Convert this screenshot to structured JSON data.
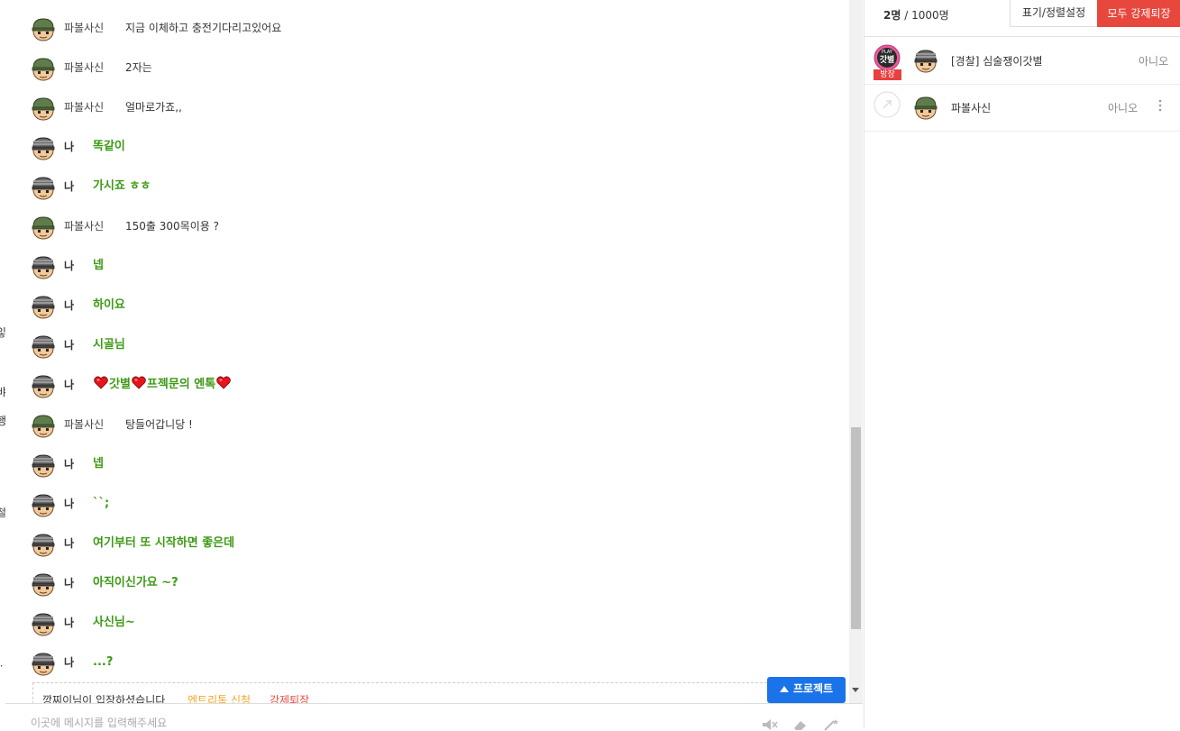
{
  "background_fragments": [
    "잏",
    "l",
    "뱌",
    "행",
    "-",
    "철",
    "-",
    "l",
    "ㆍ"
  ],
  "chat": {
    "messages": [
      {
        "nick": "파볼사신",
        "text": "지금 이체하고 충전기다리고있어요",
        "me": false
      },
      {
        "nick": "파볼사신",
        "text": "2자는",
        "me": false
      },
      {
        "nick": "파볼사신",
        "text": "얼마로가죠,,",
        "me": false
      },
      {
        "nick": "나",
        "text": "똑같이",
        "me": true
      },
      {
        "nick": "나",
        "text": "가시죠 ㅎㅎ",
        "me": true
      },
      {
        "nick": "파볼사신",
        "text": "150출 300목이용 ?",
        "me": false
      },
      {
        "nick": "나",
        "text": "넵",
        "me": true
      },
      {
        "nick": "나",
        "text": "하이요",
        "me": true
      },
      {
        "nick": "나",
        "text": "시골님",
        "me": true
      },
      {
        "nick": "나",
        "text_parts": [
          "갓별",
          "프젝문의 엔톡"
        ],
        "me": true,
        "hearts": true
      },
      {
        "nick": "파볼사신",
        "text": "탕들어갑니당 !",
        "me": false
      },
      {
        "nick": "나",
        "text": "넵",
        "me": true
      },
      {
        "nick": "나",
        "text": "``;",
        "me": true
      },
      {
        "nick": "나",
        "text": "여기부터 또 시작하면 좋은데",
        "me": true
      },
      {
        "nick": "나",
        "text": "아직이신가요 ~?",
        "me": true
      },
      {
        "nick": "나",
        "text": "사신님~",
        "me": true
      },
      {
        "nick": "나",
        "text": "...?",
        "me": true
      }
    ],
    "notice": {
      "text": "깡찌이님이 입장하셨습니다",
      "link1": "엔트리톡 신청",
      "link2": "강제퇴장"
    },
    "protect_button": "프로젝트",
    "input_placeholder": "이곳에 메시지를 입력해주세요",
    "tools": [
      "mute-icon",
      "eraser-icon",
      "magic-wand-icon"
    ]
  },
  "user_panel": {
    "count_current": "2명",
    "count_sep": " / ",
    "count_max": "1000명",
    "display_button": "표기/정렬설정",
    "kick_all_button": "모두 강제퇴장",
    "users": [
      {
        "name": "[경찰] 심술쟁이갓별",
        "status": "아니오",
        "host": true,
        "host_label": "방장",
        "badge_text": "갓별",
        "badge_top": "PLAY"
      },
      {
        "name": "파볼사신",
        "status": "아니오",
        "host": false
      }
    ]
  },
  "colors": {
    "my_message": "#3c9a14",
    "kick_button": "#e8473d",
    "protect_button": "#1a73e8",
    "notice_link1": "#f5a623",
    "notice_link2": "#e74c3c"
  }
}
